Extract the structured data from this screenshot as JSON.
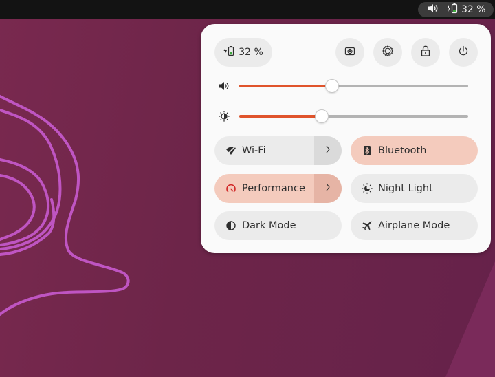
{
  "topbar": {
    "status": {
      "volume_icon": "speaker-icon",
      "battery_icon": "battery-charging-icon",
      "battery_label": "32 %"
    }
  },
  "quick_settings": {
    "battery": {
      "icon": "battery-charging-icon",
      "label": "32 %",
      "level_percent": 32
    },
    "actions": [
      {
        "name": "screenshot",
        "icon": "camera-icon"
      },
      {
        "name": "settings",
        "icon": "gear-icon"
      },
      {
        "name": "lock",
        "icon": "lock-icon"
      },
      {
        "name": "power",
        "icon": "power-icon"
      }
    ],
    "sliders": {
      "volume": {
        "icon": "speaker-icon",
        "value_percent": 40.5
      },
      "brightness": {
        "icon": "brightness-icon",
        "value_percent": 36
      }
    },
    "toggles": [
      {
        "label": "Wi-Fi",
        "icon": "wifi-disabled-icon",
        "active": false,
        "has_menu": true
      },
      {
        "label": "Bluetooth",
        "icon": "bluetooth-icon",
        "active": true,
        "has_menu": false
      },
      {
        "label": "Performance",
        "icon": "speedometer-icon",
        "active": true,
        "has_menu": true
      },
      {
        "label": "Night Light",
        "icon": "night-light-icon",
        "active": false,
        "has_menu": false
      },
      {
        "label": "Dark Mode",
        "icon": "dark-mode-icon",
        "active": false,
        "has_menu": false
      },
      {
        "label": "Airplane Mode",
        "icon": "airplane-icon",
        "active": false,
        "has_menu": false
      }
    ]
  },
  "colors": {
    "accent": "#e0542c",
    "active_toggle_bg": "#f4cbbd",
    "panel_bg": "#fafafa",
    "wallpaper": "#6d2549",
    "wallpaper_line": "#c054c0",
    "battery_fill": "#3aa63a",
    "performance_icon": "#d22a2a"
  }
}
